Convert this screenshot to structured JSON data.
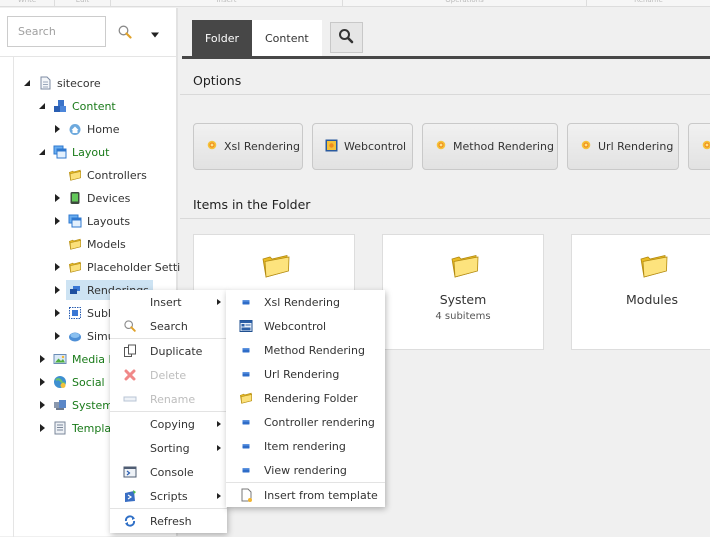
{
  "ribbon": {
    "groups": [
      "Write",
      "Edit",
      "Insert",
      "Operations",
      "Rename"
    ]
  },
  "search": {
    "placeholder": "Search",
    "value": ""
  },
  "tree": {
    "nodes": [
      {
        "label": "sitecore",
        "state": "expanded"
      },
      {
        "label": "Content",
        "state": "expanded"
      },
      {
        "label": "Home",
        "state": "collapsed"
      },
      {
        "label": "Layout",
        "state": "expanded"
      },
      {
        "label": "Controllers",
        "state": "leaf"
      },
      {
        "label": "Devices",
        "state": "collapsed"
      },
      {
        "label": "Layouts",
        "state": "collapsed"
      },
      {
        "label": "Models",
        "state": "leaf"
      },
      {
        "label": "Placeholder Settin",
        "state": "collapsed"
      },
      {
        "label": "Renderings",
        "state": "collapsed",
        "selected": true
      },
      {
        "label": "Sublayouts",
        "state": "collapsed"
      },
      {
        "label": "Simulators",
        "state": "collapsed"
      },
      {
        "label": "Media Library",
        "state": "collapsed"
      },
      {
        "label": "Social",
        "state": "collapsed"
      },
      {
        "label": "System",
        "state": "collapsed"
      },
      {
        "label": "Templates",
        "state": "collapsed"
      }
    ]
  },
  "tabs": [
    {
      "label": "Folder",
      "active": true
    },
    {
      "label": "Content",
      "active": false
    }
  ],
  "options": {
    "title": "Options",
    "buttons": [
      {
        "label": "Xsl Rendering",
        "icon": "rendering-icon"
      },
      {
        "label": "Webcontrol",
        "icon": "webcontrol-icon"
      },
      {
        "label": "Method Rendering",
        "icon": "rendering-icon"
      },
      {
        "label": "Url Rendering",
        "icon": "rendering-icon"
      },
      {
        "label": "",
        "icon": "rendering-icon"
      }
    ]
  },
  "items": {
    "title": "Items in the Folder",
    "cards": [
      {
        "title": "",
        "subtitle": ""
      },
      {
        "title": "System",
        "subtitle": "4 subitems"
      },
      {
        "title": "Modules",
        "subtitle": ""
      }
    ]
  },
  "context_menu": {
    "items": [
      {
        "label": "Insert",
        "icon": "",
        "submenu": true,
        "disabled": false
      },
      {
        "label": "Search",
        "icon": "search-icon",
        "submenu": false,
        "disabled": false
      },
      {
        "label": "Duplicate",
        "icon": "duplicate-icon",
        "submenu": false,
        "disabled": false
      },
      {
        "label": "Delete",
        "icon": "delete-icon",
        "submenu": false,
        "disabled": true
      },
      {
        "label": "Rename",
        "icon": "rename-icon",
        "submenu": false,
        "disabled": true
      },
      {
        "label": "Copying",
        "icon": "",
        "submenu": true,
        "disabled": false
      },
      {
        "label": "Sorting",
        "icon": "",
        "submenu": true,
        "disabled": false
      },
      {
        "label": "Console",
        "icon": "console-icon",
        "submenu": false,
        "disabled": false
      },
      {
        "label": "Scripts",
        "icon": "scripts-icon",
        "submenu": true,
        "disabled": false
      },
      {
        "label": "Refresh",
        "icon": "refresh-icon",
        "submenu": false,
        "disabled": false
      }
    ]
  },
  "insert_submenu": {
    "items": [
      {
        "label": "Xsl Rendering",
        "icon": "rendering-icon"
      },
      {
        "label": "Webcontrol",
        "icon": "webcontrol-icon"
      },
      {
        "label": "Method Rendering",
        "icon": "rendering-icon"
      },
      {
        "label": "Url Rendering",
        "icon": "rendering-icon"
      },
      {
        "label": "Rendering Folder",
        "icon": "folder-icon"
      },
      {
        "label": "Controller rendering",
        "icon": "rendering-icon"
      },
      {
        "label": "Item rendering",
        "icon": "rendering-icon"
      },
      {
        "label": "View rendering",
        "icon": "rendering-icon"
      },
      {
        "label": "Insert from template",
        "icon": "template-icon"
      }
    ]
  }
}
